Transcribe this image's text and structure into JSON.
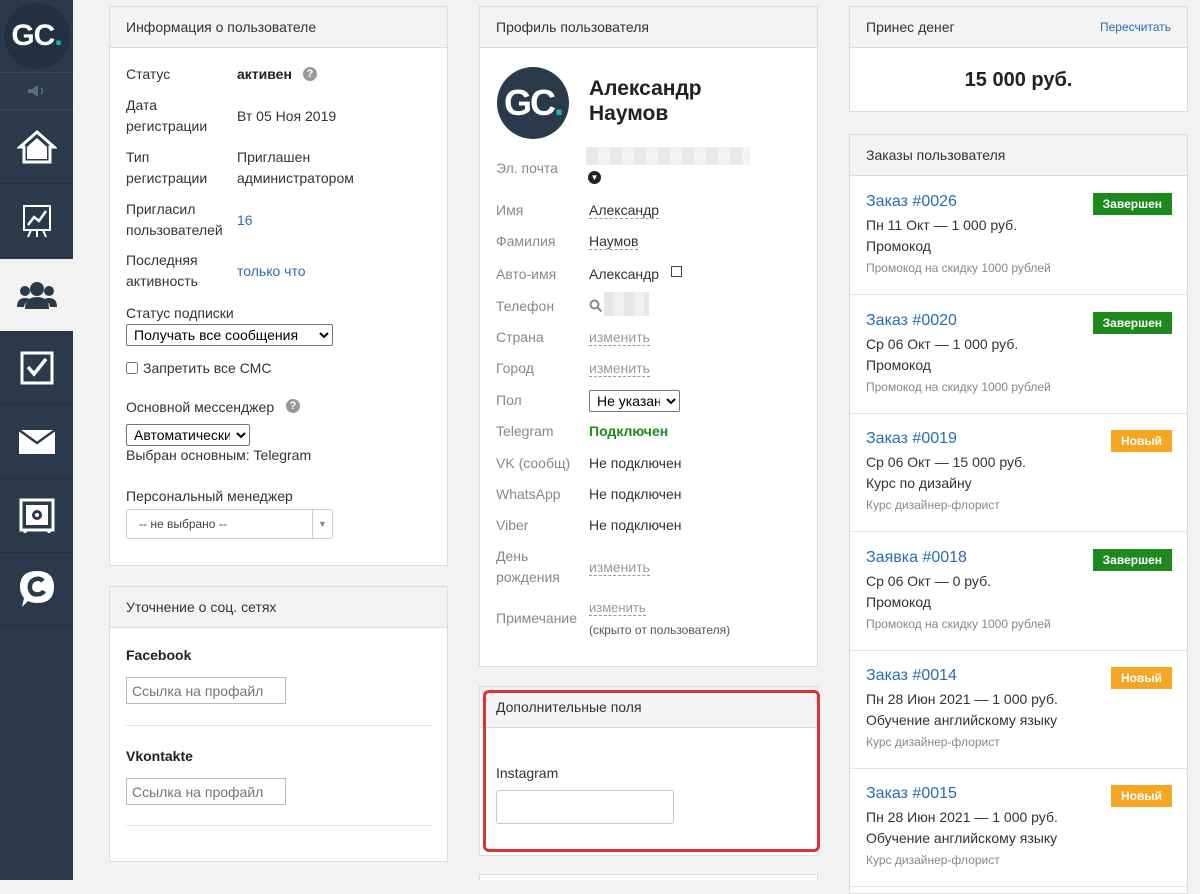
{
  "logo": {
    "text": "GC",
    "dot": "."
  },
  "nav": [
    "home-icon",
    "chart-icon",
    "users-icon",
    "tasks-icon",
    "mail-icon",
    "safe-icon",
    "chat-icon"
  ],
  "user_info": {
    "title": "Информация о пользователе",
    "status_label": "Статус",
    "status_value": "активен",
    "reg_date_label_1": "Дата",
    "reg_date_label_2": "регистрации",
    "reg_date_value": "Вт 05 Ноя 2019",
    "reg_type_label_1": "Тип",
    "reg_type_label_2": "регистрации",
    "reg_type_value_1": "Приглашен",
    "reg_type_value_2": "администратором",
    "invited_label_1": "Пригласил",
    "invited_label_2": "пользователей",
    "invited_value": "16",
    "last_active_label_1": "Последняя",
    "last_active_label_2": "активность",
    "last_active_value": "только что",
    "subscription_label": "Статус подписки",
    "subscription_value": "Получать все сообщения",
    "sms_label": "Запретить все СМС",
    "messenger_label": "Основной мессенджер",
    "messenger_value": "Автоматически",
    "messenger_note": "Выбран основным: Telegram",
    "manager_label": "Персональный менеджер",
    "manager_value": "-- не выбрано --"
  },
  "social": {
    "title": "Уточнение о соц. сетях",
    "facebook_label": "Facebook",
    "facebook_placeholder": "Ссылка на профайл",
    "vk_label": "Vkontakte",
    "vk_placeholder": "Ссылка на профайл"
  },
  "profile": {
    "title": "Профиль пользователя",
    "first_name_heading": "Александр",
    "last_name_heading": "Наумов",
    "email_label": "Эл. почта",
    "name_label": "Имя",
    "name_value": "Александр",
    "surname_label": "Фамилия",
    "surname_value": "Наумов",
    "autoname_label": "Авто-имя",
    "autoname_value": "Александр",
    "phone_label": "Телефон",
    "country_label": "Страна",
    "country_value": "изменить",
    "city_label": "Город",
    "city_value": "изменить",
    "gender_label": "Пол",
    "gender_value": "Не указан",
    "telegram_label": "Telegram",
    "telegram_value": "Подключен",
    "vk_label": "VK (сообщ)",
    "vk_value": "Не подключен",
    "whatsapp_label": "WhatsApp",
    "whatsapp_value": "Не подключен",
    "viber_label": "Viber",
    "viber_value": "Не подключен",
    "birthday_label_1": "День",
    "birthday_label_2": "рождения",
    "birthday_value": "изменить",
    "note_label": "Примечание",
    "note_value": "изменить",
    "note_hint": "(скрыто от пользователя)"
  },
  "extra": {
    "title": "Дополнительные поля",
    "instagram_label": "Instagram",
    "highlight_color": "#e03030"
  },
  "money": {
    "title": "Принес денег",
    "recalc": "Пересчитать",
    "amount": "15 000 руб."
  },
  "orders": {
    "title": "Заказы пользователя",
    "items": [
      {
        "title": "Заказ #0026",
        "line2": "Пн 11 Окт — 1 000 руб.",
        "line3": "Промокод",
        "line4": "Промокод на скидку 1000 рублей",
        "status": "Завершен",
        "kind": "done"
      },
      {
        "title": "Заказ #0020",
        "line2": "Ср 06 Окт — 1 000 руб.",
        "line3": "Промокод",
        "line4": "Промокод на скидку 1000 рублей",
        "status": "Завершен",
        "kind": "done"
      },
      {
        "title": "Заказ #0019",
        "line2": "Ср 06 Окт — 15 000 руб.",
        "line3": "Курс по дизайну",
        "line4": "Курс дизайнер-флорист",
        "status": "Новый",
        "kind": "new"
      },
      {
        "title": "Заявка #0018",
        "line2": "Ср 06 Окт — 0 руб.",
        "line3": "Промокод",
        "line4": "Промокод на скидку 1000 рублей",
        "status": "Завершен",
        "kind": "done"
      },
      {
        "title": "Заказ #0014",
        "line2": "Пн 28 Июн 2021 — 1 000 руб.",
        "line3": "Обучение английскому языку",
        "line4": "Курс дизайнер-флорист",
        "status": "Новый",
        "kind": "new"
      },
      {
        "title": "Заказ #0015",
        "line2": "Пн 28 Июн 2021 — 1 000 руб.",
        "line3": "Обучение английскому языку",
        "line4": "Курс дизайнер-флорист",
        "status": "Новый",
        "kind": "new"
      }
    ]
  }
}
